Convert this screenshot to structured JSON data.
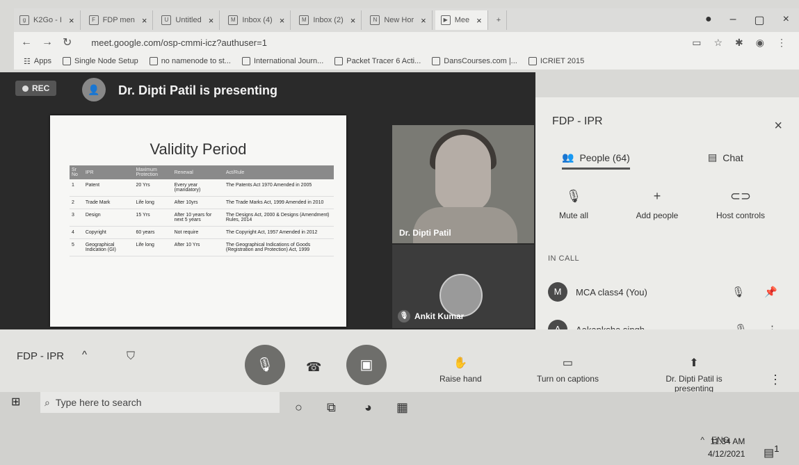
{
  "browser": {
    "tabs": [
      {
        "label": "K2Go - I",
        "icon": "g"
      },
      {
        "label": "FDP men",
        "icon": "F"
      },
      {
        "label": "Untitled",
        "icon": "U"
      },
      {
        "label": "Inbox (4)",
        "icon": "M"
      },
      {
        "label": "Inbox (2)",
        "icon": "M"
      },
      {
        "label": "New Hor",
        "icon": "N"
      },
      {
        "label": "Mee",
        "icon": "▶"
      }
    ],
    "new_tab": "+",
    "url": "meet.google.com/osp-cmmi-icz?authuser=1",
    "bookmarks": [
      "Apps",
      "Single Node Setup",
      "no namenode to st...",
      "International Journ...",
      "Packet Tracer 6 Acti...",
      "DansCourses.com |...",
      "ICRIET 2015"
    ]
  },
  "meet": {
    "rec_label": "REC",
    "presenter_text": "Dr. Dipti Patil is presenting",
    "slide": {
      "title": "Validity Period",
      "columns": [
        "Sr No",
        "IPR",
        "Maximum Protection",
        "Renewal",
        "Act/Rule"
      ],
      "rows": [
        [
          "1",
          "Patent",
          "20 Yrs",
          "Every year (mandatory)",
          "The Patents Act 1970 Amended in 2005"
        ],
        [
          "2",
          "Trade Mark",
          "Life long",
          "After 10yrs",
          "The Trade Marks Act, 1999 Amended in 2010"
        ],
        [
          "3",
          "Design",
          "15 Yrs",
          "After 10 years for next 5 years",
          "The Designs Act, 2000 & Designs (Amendment) Rules, 2014"
        ],
        [
          "4",
          "Copyright",
          "60 years",
          "Not require",
          "The Copyright Act, 1957 Amended in 2012"
        ],
        [
          "5",
          "Geographical Indication (GI)",
          "Life long",
          "After 10 Yrs",
          "The Geographical Indications of Goods (Registration and Protection) Act, 1999"
        ]
      ]
    },
    "tiles": [
      {
        "name": "Dr. Dipti Patil"
      },
      {
        "name": "Ankit Kumar"
      }
    ],
    "meeting_name": "FDP - IPR",
    "controls": {
      "raise_hand": "Raise hand",
      "captions": "Turn on captions",
      "presenting": "Dr. Dipti Patil is presenting"
    }
  },
  "panel": {
    "title": "FDP - IPR",
    "tab_people": "People (64)",
    "tab_chat": "Chat",
    "actions": [
      "Mute all",
      "Add people",
      "Host controls"
    ],
    "in_call_label": "IN CALL",
    "people": [
      {
        "initial": "M",
        "name": "MCA class4 (You)"
      },
      {
        "initial": "A",
        "name": "Aakanksha singh"
      }
    ]
  },
  "taskbar": {
    "search_placeholder": "Type here to search",
    "lang": "ENG",
    "time": "11:34 AM",
    "date": "4/12/2021",
    "notif_count": "1"
  }
}
